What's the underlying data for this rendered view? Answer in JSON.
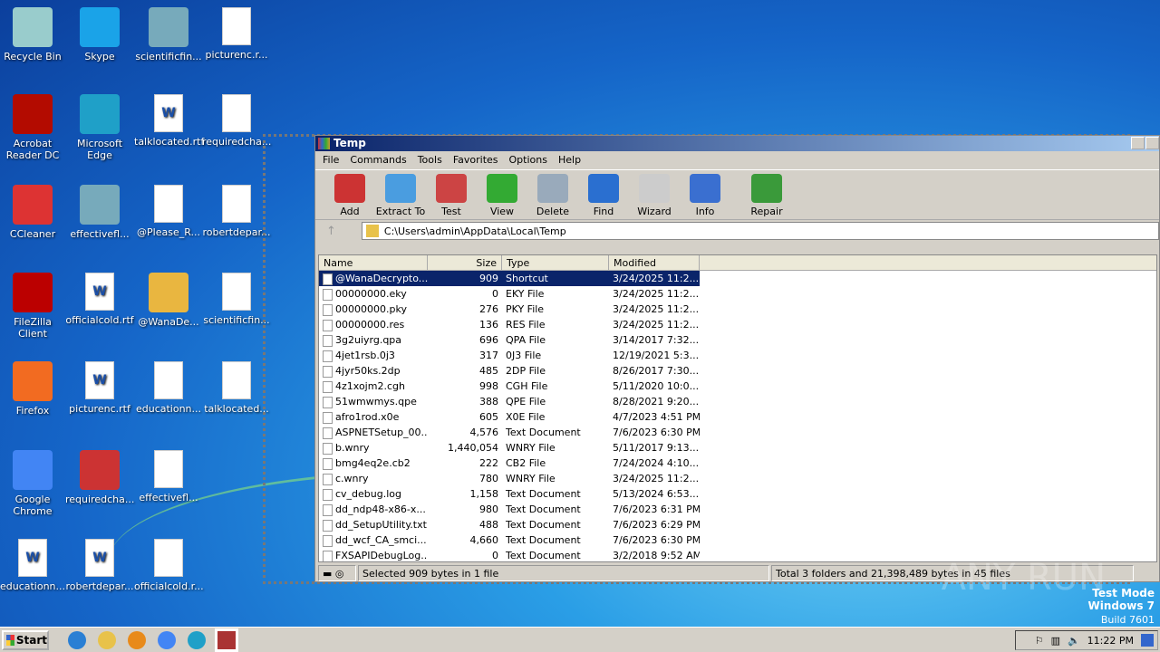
{
  "desktop": {
    "icons": [
      {
        "label": "Recycle Bin",
        "col": 0,
        "row": 0,
        "icon": "recycle-bin-icon",
        "color": "#9cc"
      },
      {
        "label": "Skype",
        "col": 1,
        "row": 0,
        "icon": "skype-icon",
        "color": "#1aa3e8"
      },
      {
        "label": "scientificfin...",
        "col": 2,
        "row": 0,
        "icon": "image-file-icon",
        "color": "#7ab"
      },
      {
        "label": "picturenc.r...",
        "col": 3,
        "row": 0,
        "icon": "file-icon",
        "color": "doc"
      },
      {
        "label": "Acrobat Reader DC",
        "col": 0,
        "row": 1,
        "icon": "acrobat-icon",
        "color": "#b30b00"
      },
      {
        "label": "Microsoft Edge",
        "col": 1,
        "row": 1,
        "icon": "edge-icon",
        "color": "#1fa0c8"
      },
      {
        "label": "talklocated.rtf",
        "col": 2,
        "row": 1,
        "icon": "word-doc-icon",
        "color": "doc"
      },
      {
        "label": "requiredcha...",
        "col": 3,
        "row": 1,
        "icon": "file-icon",
        "color": "doc"
      },
      {
        "label": "CCleaner",
        "col": 0,
        "row": 2,
        "icon": "ccleaner-icon",
        "color": "#d33"
      },
      {
        "label": "effectivefl...",
        "col": 1,
        "row": 2,
        "icon": "image-file-icon",
        "color": "#7ab"
      },
      {
        "label": "@Please_R...",
        "col": 2,
        "row": 2,
        "icon": "text-file-icon",
        "color": "doc"
      },
      {
        "label": "robertdepar...",
        "col": 3,
        "row": 2,
        "icon": "file-icon",
        "color": "doc"
      },
      {
        "label": "FileZilla Client",
        "col": 0,
        "row": 3,
        "icon": "filezilla-icon",
        "color": "#b00"
      },
      {
        "label": "officialcold.rtf",
        "col": 1,
        "row": 3,
        "icon": "word-doc-icon",
        "color": "doc"
      },
      {
        "label": "@WanaDe...",
        "col": 2,
        "row": 3,
        "icon": "handshake-icon",
        "color": "#e9b640"
      },
      {
        "label": "scientificfin...",
        "col": 3,
        "row": 3,
        "icon": "file-icon",
        "color": "doc"
      },
      {
        "label": "Firefox",
        "col": 0,
        "row": 4,
        "icon": "firefox-icon",
        "color": "#f26b21"
      },
      {
        "label": "picturenc.rtf",
        "col": 1,
        "row": 4,
        "icon": "word-doc-icon",
        "color": "doc"
      },
      {
        "label": "educationn...",
        "col": 2,
        "row": 4,
        "icon": "file-icon",
        "color": "doc"
      },
      {
        "label": "talklocated...",
        "col": 3,
        "row": 4,
        "icon": "file-icon",
        "color": "doc"
      },
      {
        "label": "Google Chrome",
        "col": 0,
        "row": 5,
        "icon": "chrome-icon",
        "color": "#4285f4"
      },
      {
        "label": "requiredcha...",
        "col": 1,
        "row": 5,
        "icon": "image-file-icon",
        "color": "#c33"
      },
      {
        "label": "effectivefl...",
        "col": 2,
        "row": 5,
        "icon": "file-icon",
        "color": "doc"
      },
      {
        "label": "educationn...",
        "col": 0,
        "row": 6,
        "icon": "word-doc-icon",
        "color": "doc"
      },
      {
        "label": "robertdepar...",
        "col": 1,
        "row": 6,
        "icon": "word-doc-icon",
        "color": "doc"
      },
      {
        "label": "officialcold.r...",
        "col": 2,
        "row": 6,
        "icon": "file-icon",
        "color": "doc"
      }
    ]
  },
  "window": {
    "title": "Temp",
    "menu": [
      "File",
      "Commands",
      "Tools",
      "Favorites",
      "Options",
      "Help"
    ],
    "toolbar": [
      {
        "label": "Add",
        "color": "#c33"
      },
      {
        "label": "Extract To",
        "color": "#4a9de0"
      },
      {
        "label": "Test",
        "color": "#c44"
      },
      {
        "label": "View",
        "color": "#3a3"
      },
      {
        "label": "Delete",
        "color": "#9ab"
      },
      {
        "label": "Find",
        "color": "#2a6fd0"
      },
      {
        "label": "Wizard",
        "color": "#ccc"
      },
      {
        "label": "Info",
        "color": "#3a6fd0"
      },
      {
        "label": "Repair",
        "color": "#3a9a3a"
      }
    ],
    "path": "C:\\Users\\admin\\AppData\\Local\\Temp",
    "columns": [
      "Name",
      "Size",
      "Type",
      "Modified"
    ],
    "files": [
      [
        "@WanaDecrypto...",
        "909",
        "Shortcut",
        "3/24/2025 11:2..."
      ],
      [
        "00000000.eky",
        "0",
        "EKY File",
        "3/24/2025 11:2..."
      ],
      [
        "00000000.pky",
        "276",
        "PKY File",
        "3/24/2025 11:2..."
      ],
      [
        "00000000.res",
        "136",
        "RES File",
        "3/24/2025 11:2..."
      ],
      [
        "3g2uiyrg.qpa",
        "696",
        "QPA File",
        "3/14/2017 7:32..."
      ],
      [
        "4jet1rsb.0j3",
        "317",
        "0J3 File",
        "12/19/2021 5:3..."
      ],
      [
        "4jyr50ks.2dp",
        "485",
        "2DP File",
        "8/26/2017 7:30..."
      ],
      [
        "4z1xojm2.cgh",
        "998",
        "CGH File",
        "5/11/2020 10:0..."
      ],
      [
        "51wmwmys.qpe",
        "388",
        "QPE File",
        "8/28/2021 9:20..."
      ],
      [
        "afro1rod.x0e",
        "605",
        "X0E File",
        "4/7/2023 4:51 PM"
      ],
      [
        "ASPNETSetup_00...",
        "4,576",
        "Text Document",
        "7/6/2023 6:30 PM"
      ],
      [
        "b.wnry",
        "1,440,054",
        "WNRY File",
        "5/11/2017 9:13..."
      ],
      [
        "bmg4eq2e.cb2",
        "222",
        "CB2 File",
        "7/24/2024 4:10..."
      ],
      [
        "c.wnry",
        "780",
        "WNRY File",
        "3/24/2025 11:2..."
      ],
      [
        "cv_debug.log",
        "1,158",
        "Text Document",
        "5/13/2024 6:53..."
      ],
      [
        "dd_ndp48-x86-x...",
        "980",
        "Text Document",
        "7/6/2023 6:31 PM"
      ],
      [
        "dd_SetupUtility.txt",
        "488",
        "Text Document",
        "7/6/2023 6:29 PM"
      ],
      [
        "dd_wcf_CA_smci...",
        "4,660",
        "Text Document",
        "7/6/2023 6:30 PM"
      ],
      [
        "FXSAPIDebugLog...",
        "0",
        "Text Document",
        "3/2/2018 9:52 AM"
      ]
    ],
    "status_left": "Selected 909 bytes in 1 file",
    "status_right": "Total 3 folders and 21,398,489 bytes in 45 files"
  },
  "watermark": {
    "line1": "Test Mode",
    "line2": "Windows 7",
    "line3": "Build 7601",
    "brand": "ANY RUN"
  },
  "taskbar": {
    "start": "Start",
    "clock": "11:22 PM",
    "apps": [
      {
        "name": "ie",
        "color": "#2a7fd4"
      },
      {
        "name": "explorer",
        "color": "#e8c24a"
      },
      {
        "name": "media-player",
        "color": "#e88a1a"
      },
      {
        "name": "chrome",
        "color": "#4285f4"
      },
      {
        "name": "edge",
        "color": "#1fa0c8"
      },
      {
        "name": "winrar",
        "color": "#a33"
      }
    ]
  }
}
